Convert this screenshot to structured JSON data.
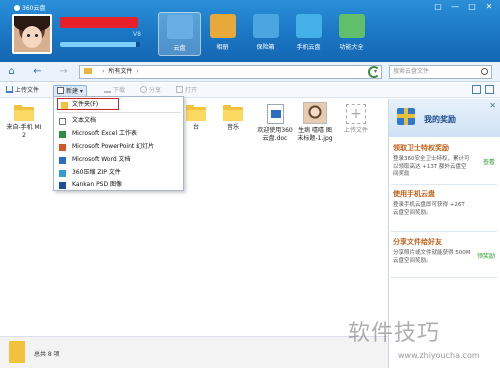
{
  "app": {
    "title": "360云盘",
    "controls": [
      "▢",
      "—",
      "□",
      "✕"
    ]
  },
  "user": {
    "vip": "V8",
    "space_used_fraction": 0.95
  },
  "top_nav": [
    {
      "label": "云盘",
      "color": "#6aaee6",
      "active": true
    },
    {
      "label": "相册",
      "color": "#e7a93a",
      "active": false
    },
    {
      "label": "保险箱",
      "color": "#4ba5e0",
      "active": false
    },
    {
      "label": "手机云盘",
      "color": "#44b0e8",
      "active": false
    },
    {
      "label": "功能大全",
      "color": "#5fbf6a",
      "active": false
    }
  ],
  "address": {
    "back": "←",
    "forward": "→",
    "home": "⌂",
    "path_label": "所有文件",
    "sep": "›",
    "search_placeholder": "搜索云盘文件"
  },
  "toolbar": {
    "upload": "上传文件",
    "new": "新建",
    "download": "下载",
    "share": "分享",
    "open": "打开"
  },
  "files": [
    {
      "name": "来自-手机 MI 2",
      "type": "folder"
    },
    {
      "name": "",
      "type": "folder"
    },
    {
      "name": "",
      "type": "folder"
    },
    {
      "name": "",
      "type": "folder"
    },
    {
      "name": "台",
      "type": "folder"
    },
    {
      "name": "音乐",
      "type": "folder"
    },
    {
      "name": "欢迎使用360云盘.doc",
      "type": "doc"
    },
    {
      "name": "生病 嘻嘻 图 末标题-1.jpg",
      "type": "image"
    },
    {
      "name": "上传文件",
      "type": "upload"
    }
  ],
  "dropdown": [
    {
      "label": "文件夹(F)",
      "icon": "folder",
      "highlight": true
    },
    {
      "label": "文本文档",
      "icon": "text"
    },
    {
      "label": "Microsoft Excel 工作表",
      "icon": "excel"
    },
    {
      "label": "Microsoft PowerPoint 幻灯片",
      "icon": "ppt"
    },
    {
      "label": "Microsoft Word 文档",
      "icon": "word"
    },
    {
      "label": "360压缩 ZIP 文件",
      "icon": "zip"
    },
    {
      "label": "Kankan PSD 图像",
      "icon": "psd"
    }
  ],
  "rewards": {
    "title": "我的奖励",
    "items": [
      {
        "title": "领取卫士特权奖励",
        "desc": "登录360安全卫士特权，累计可以领取高达 +13T 额外云盘空间奖励",
        "action": "查看"
      },
      {
        "title": "使用手机云盘",
        "desc": "登录手机云盘即可获得 +26T 云盘空间奖励。",
        "action": ""
      },
      {
        "title": "分享文件给好友",
        "desc": "分享照片或文件就能获得 500M 云盘空间奖励。",
        "action": "领奖励"
      }
    ]
  },
  "status": {
    "text": "总共 8 项"
  },
  "watermark": {
    "main": "软件技巧",
    "sub": "www.zhiyoucha.com"
  }
}
